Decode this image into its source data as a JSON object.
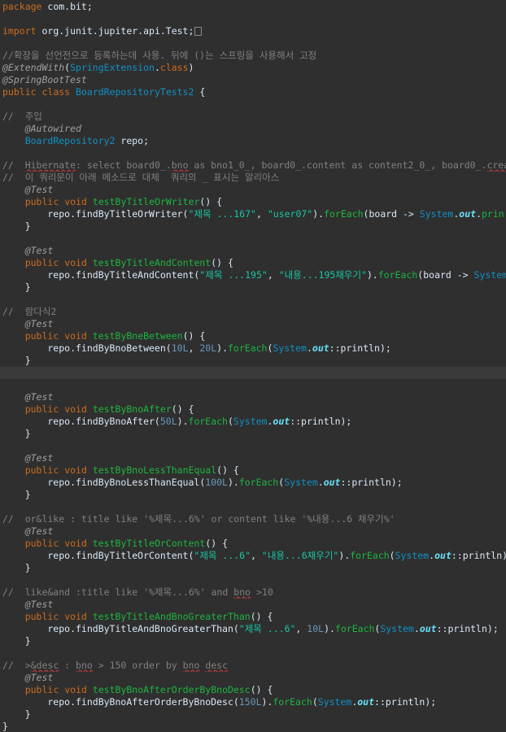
{
  "editor": {
    "current_line": 30,
    "lines": [
      {
        "tokens": [
          {
            "t": "package",
            "c": "kw"
          },
          {
            "t": " com.bit;",
            "c": "tx"
          }
        ]
      },
      {
        "tokens": []
      },
      {
        "tokens": [
          {
            "t": "import",
            "c": "kw"
          },
          {
            "t": " org.junit.jupiter.api.Test;",
            "c": "tx"
          }
        ],
        "fold": true
      },
      {
        "tokens": []
      },
      {
        "tokens": [
          {
            "t": "//확장을 선언전으로 등록하는데 사용. 뒤에 ()는 스프링을 사용해서 고정",
            "c": "cm"
          }
        ]
      },
      {
        "tokens": [
          {
            "t": "@ExtendWith",
            "c": "ann"
          },
          {
            "t": "(",
            "c": "tx"
          },
          {
            "t": "SpringExtension",
            "c": "cls"
          },
          {
            "t": ".",
            "c": "tx"
          },
          {
            "t": "class",
            "c": "kw"
          },
          {
            "t": ")",
            "c": "tx"
          }
        ]
      },
      {
        "tokens": [
          {
            "t": "@SpringBootTest",
            "c": "ann"
          }
        ]
      },
      {
        "tokens": [
          {
            "t": "public",
            "c": "kw"
          },
          {
            "t": " ",
            "c": "tx"
          },
          {
            "t": "class",
            "c": "kw"
          },
          {
            "t": " ",
            "c": "tx"
          },
          {
            "t": "BoardRepositoryTests2",
            "c": "cls"
          },
          {
            "t": " {",
            "c": "tx"
          }
        ]
      },
      {
        "tokens": []
      },
      {
        "tokens": [
          {
            "t": "//  주입",
            "c": "cm"
          }
        ]
      },
      {
        "tokens": [
          {
            "t": "    ",
            "c": "tx"
          },
          {
            "t": "@Autowired",
            "c": "ann"
          }
        ]
      },
      {
        "tokens": [
          {
            "t": "    ",
            "c": "tx"
          },
          {
            "t": "BoardRepository2",
            "c": "cls"
          },
          {
            "t": " repo;",
            "c": "tx"
          }
        ]
      },
      {
        "tokens": []
      },
      {
        "tokens": [
          {
            "t": "//  ",
            "c": "cm"
          },
          {
            "t": "Hibernate",
            "c": "cm",
            "sq": true
          },
          {
            "t": ": select board0_.",
            "c": "cm"
          },
          {
            "t": "bno",
            "c": "cm",
            "sq": true
          },
          {
            "t": " as bno1_0_, board0_.content as content2_0_, board0_.",
            "c": "cm"
          },
          {
            "t": "crea",
            "c": "cm",
            "sq": true
          }
        ]
      },
      {
        "tokens": [
          {
            "t": "//  이 쿼리문이 아래 메소드로 대체  쿼리의 _ 표시는 알리아스",
            "c": "cm"
          }
        ]
      },
      {
        "tokens": [
          {
            "t": "    ",
            "c": "tx"
          },
          {
            "t": "@Test",
            "c": "ann"
          }
        ]
      },
      {
        "tokens": [
          {
            "t": "    ",
            "c": "tx"
          },
          {
            "t": "public",
            "c": "kw"
          },
          {
            "t": " ",
            "c": "tx"
          },
          {
            "t": "void",
            "c": "kw"
          },
          {
            "t": " ",
            "c": "tx"
          },
          {
            "t": "testByTitleOrWriter",
            "c": "mth"
          },
          {
            "t": "() {",
            "c": "tx"
          }
        ]
      },
      {
        "tokens": [
          {
            "t": "        repo.findByTitleOrWriter(",
            "c": "tx"
          },
          {
            "t": "\"제목 ...167\"",
            "c": "str"
          },
          {
            "t": ", ",
            "c": "tx"
          },
          {
            "t": "\"user07\"",
            "c": "str"
          },
          {
            "t": ").",
            "c": "tx"
          },
          {
            "t": "forEach",
            "c": "mth"
          },
          {
            "t": "(board -> ",
            "c": "tx"
          },
          {
            "t": "System",
            "c": "cls"
          },
          {
            "t": ".",
            "c": "tx"
          },
          {
            "t": "out",
            "c": "fld"
          },
          {
            "t": ".",
            "c": "tx"
          },
          {
            "t": "prin",
            "c": "mth"
          }
        ]
      },
      {
        "tokens": [
          {
            "t": "    }",
            "c": "tx"
          }
        ]
      },
      {
        "tokens": []
      },
      {
        "tokens": [
          {
            "t": "    ",
            "c": "tx"
          },
          {
            "t": "@Test",
            "c": "ann"
          }
        ]
      },
      {
        "tokens": [
          {
            "t": "    ",
            "c": "tx"
          },
          {
            "t": "public",
            "c": "kw"
          },
          {
            "t": " ",
            "c": "tx"
          },
          {
            "t": "void",
            "c": "kw"
          },
          {
            "t": " ",
            "c": "tx"
          },
          {
            "t": "testByTitleAndContent",
            "c": "mth"
          },
          {
            "t": "() {",
            "c": "tx"
          }
        ]
      },
      {
        "tokens": [
          {
            "t": "        repo.findByTitleAndContent(",
            "c": "tx"
          },
          {
            "t": "\"제목 ...195\"",
            "c": "str"
          },
          {
            "t": ", ",
            "c": "tx"
          },
          {
            "t": "\"내용...195채우기\"",
            "c": "str"
          },
          {
            "t": ").",
            "c": "tx"
          },
          {
            "t": "forEach",
            "c": "mth"
          },
          {
            "t": "(board -> ",
            "c": "tx"
          },
          {
            "t": "System",
            "c": "cls"
          }
        ]
      },
      {
        "tokens": [
          {
            "t": "    }",
            "c": "tx"
          }
        ]
      },
      {
        "tokens": []
      },
      {
        "tokens": [
          {
            "t": "//  람다식2",
            "c": "cm"
          }
        ]
      },
      {
        "tokens": [
          {
            "t": "    ",
            "c": "tx"
          },
          {
            "t": "@Test",
            "c": "ann"
          }
        ]
      },
      {
        "tokens": [
          {
            "t": "    ",
            "c": "tx"
          },
          {
            "t": "public",
            "c": "kw"
          },
          {
            "t": " ",
            "c": "tx"
          },
          {
            "t": "void",
            "c": "kw"
          },
          {
            "t": " ",
            "c": "tx"
          },
          {
            "t": "testByBneBetween",
            "c": "mth"
          },
          {
            "t": "() {",
            "c": "tx"
          }
        ]
      },
      {
        "tokens": [
          {
            "t": "        repo.findByBnoBetween(",
            "c": "tx"
          },
          {
            "t": "10L",
            "c": "num"
          },
          {
            "t": ", ",
            "c": "tx"
          },
          {
            "t": "20L",
            "c": "num"
          },
          {
            "t": ").",
            "c": "tx"
          },
          {
            "t": "forEach",
            "c": "mth"
          },
          {
            "t": "(",
            "c": "tx"
          },
          {
            "t": "System",
            "c": "cls"
          },
          {
            "t": ".",
            "c": "tx"
          },
          {
            "t": "out",
            "c": "fld"
          },
          {
            "t": "::println);",
            "c": "tx"
          }
        ]
      },
      {
        "tokens": [
          {
            "t": "    }",
            "c": "tx"
          }
        ]
      },
      {
        "tokens": []
      },
      {
        "tokens": []
      },
      {
        "tokens": [
          {
            "t": "    ",
            "c": "tx"
          },
          {
            "t": "@Test",
            "c": "ann"
          }
        ]
      },
      {
        "tokens": [
          {
            "t": "    ",
            "c": "tx"
          },
          {
            "t": "public",
            "c": "kw"
          },
          {
            "t": " ",
            "c": "tx"
          },
          {
            "t": "void",
            "c": "kw"
          },
          {
            "t": " ",
            "c": "tx"
          },
          {
            "t": "testByBnoAfter",
            "c": "mth"
          },
          {
            "t": "() {",
            "c": "tx"
          }
        ]
      },
      {
        "tokens": [
          {
            "t": "        repo.findByBnoAfter(",
            "c": "tx"
          },
          {
            "t": "50L",
            "c": "num"
          },
          {
            "t": ").",
            "c": "tx"
          },
          {
            "t": "forEach",
            "c": "mth"
          },
          {
            "t": "(",
            "c": "tx"
          },
          {
            "t": "System",
            "c": "cls"
          },
          {
            "t": ".",
            "c": "tx"
          },
          {
            "t": "out",
            "c": "fld"
          },
          {
            "t": "::println);",
            "c": "tx"
          }
        ]
      },
      {
        "tokens": [
          {
            "t": "    }",
            "c": "tx"
          }
        ]
      },
      {
        "tokens": []
      },
      {
        "tokens": [
          {
            "t": "    ",
            "c": "tx"
          },
          {
            "t": "@Test",
            "c": "ann"
          }
        ]
      },
      {
        "tokens": [
          {
            "t": "    ",
            "c": "tx"
          },
          {
            "t": "public",
            "c": "kw"
          },
          {
            "t": " ",
            "c": "tx"
          },
          {
            "t": "void",
            "c": "kw"
          },
          {
            "t": " ",
            "c": "tx"
          },
          {
            "t": "testByBnoLessThanEqual",
            "c": "mth"
          },
          {
            "t": "() {",
            "c": "tx"
          }
        ]
      },
      {
        "tokens": [
          {
            "t": "        repo.findByBnoLessThanEqual(",
            "c": "tx"
          },
          {
            "t": "100L",
            "c": "num"
          },
          {
            "t": ").",
            "c": "tx"
          },
          {
            "t": "forEach",
            "c": "mth"
          },
          {
            "t": "(",
            "c": "tx"
          },
          {
            "t": "System",
            "c": "cls"
          },
          {
            "t": ".",
            "c": "tx"
          },
          {
            "t": "out",
            "c": "fld"
          },
          {
            "t": "::println);",
            "c": "tx"
          }
        ]
      },
      {
        "tokens": [
          {
            "t": "    }",
            "c": "tx"
          }
        ]
      },
      {
        "tokens": []
      },
      {
        "tokens": [
          {
            "t": "//  or&like : title like '%제목...6%' or content like '%내용...6 채우기%'",
            "c": "cm"
          }
        ]
      },
      {
        "tokens": [
          {
            "t": "    ",
            "c": "tx"
          },
          {
            "t": "@Test",
            "c": "ann"
          }
        ]
      },
      {
        "tokens": [
          {
            "t": "    ",
            "c": "tx"
          },
          {
            "t": "public",
            "c": "kw"
          },
          {
            "t": " ",
            "c": "tx"
          },
          {
            "t": "void",
            "c": "kw"
          },
          {
            "t": " ",
            "c": "tx"
          },
          {
            "t": "testByTitleOrContent",
            "c": "mth"
          },
          {
            "t": "() {",
            "c": "tx"
          }
        ]
      },
      {
        "tokens": [
          {
            "t": "        repo.findByTitleOrContent(",
            "c": "tx"
          },
          {
            "t": "\"제목 ...6\"",
            "c": "str"
          },
          {
            "t": ", ",
            "c": "tx"
          },
          {
            "t": "\"내용...6채우기\"",
            "c": "str"
          },
          {
            "t": ").",
            "c": "tx"
          },
          {
            "t": "forEach",
            "c": "mth"
          },
          {
            "t": "(",
            "c": "tx"
          },
          {
            "t": "System",
            "c": "cls"
          },
          {
            "t": ".",
            "c": "tx"
          },
          {
            "t": "out",
            "c": "fld"
          },
          {
            "t": "::println)",
            "c": "tx"
          }
        ]
      },
      {
        "tokens": [
          {
            "t": "    }",
            "c": "tx"
          }
        ]
      },
      {
        "tokens": []
      },
      {
        "tokens": [
          {
            "t": "//  like&and :title like '%제목...6%' and ",
            "c": "cm"
          },
          {
            "t": "bno",
            "c": "cm",
            "sq": true
          },
          {
            "t": " >10",
            "c": "cm"
          }
        ]
      },
      {
        "tokens": [
          {
            "t": "    ",
            "c": "tx"
          },
          {
            "t": "@Test",
            "c": "ann"
          }
        ]
      },
      {
        "tokens": [
          {
            "t": "    ",
            "c": "tx"
          },
          {
            "t": "public",
            "c": "kw"
          },
          {
            "t": " ",
            "c": "tx"
          },
          {
            "t": "void",
            "c": "kw"
          },
          {
            "t": " ",
            "c": "tx"
          },
          {
            "t": "testByTitleAndBnoGreaterThan",
            "c": "mth"
          },
          {
            "t": "() {",
            "c": "tx"
          }
        ]
      },
      {
        "tokens": [
          {
            "t": "        repo.findByTitleAndBnoGreaterThan(",
            "c": "tx"
          },
          {
            "t": "\"제목 ...6\"",
            "c": "str"
          },
          {
            "t": ", ",
            "c": "tx"
          },
          {
            "t": "10L",
            "c": "num"
          },
          {
            "t": ").",
            "c": "tx"
          },
          {
            "t": "forEach",
            "c": "mth"
          },
          {
            "t": "(",
            "c": "tx"
          },
          {
            "t": "System",
            "c": "cls"
          },
          {
            "t": ".",
            "c": "tx"
          },
          {
            "t": "out",
            "c": "fld"
          },
          {
            "t": "::println);",
            "c": "tx"
          }
        ]
      },
      {
        "tokens": [
          {
            "t": "    }",
            "c": "tx"
          }
        ]
      },
      {
        "tokens": []
      },
      {
        "tokens": [
          {
            "t": "//  >",
            "c": "cm"
          },
          {
            "t": "&desc",
            "c": "cm",
            "sq": true
          },
          {
            "t": " : ",
            "c": "cm"
          },
          {
            "t": "bno",
            "c": "cm",
            "sq": true
          },
          {
            "t": " > 150 order by ",
            "c": "cm"
          },
          {
            "t": "bno",
            "c": "cm",
            "sq": true
          },
          {
            "t": " ",
            "c": "cm"
          },
          {
            "t": "desc",
            "c": "cm",
            "sq": true
          }
        ]
      },
      {
        "tokens": [
          {
            "t": "    ",
            "c": "tx"
          },
          {
            "t": "@Test",
            "c": "ann"
          }
        ]
      },
      {
        "tokens": [
          {
            "t": "    ",
            "c": "tx"
          },
          {
            "t": "public",
            "c": "kw"
          },
          {
            "t": " ",
            "c": "tx"
          },
          {
            "t": "void",
            "c": "kw"
          },
          {
            "t": " ",
            "c": "tx"
          },
          {
            "t": "testByBnoAfterOrderByBnoDesc",
            "c": "mth"
          },
          {
            "t": "() {",
            "c": "tx"
          }
        ]
      },
      {
        "tokens": [
          {
            "t": "        repo.findByBnoAfterOrderByBnoDesc(",
            "c": "tx"
          },
          {
            "t": "150L",
            "c": "num"
          },
          {
            "t": ").",
            "c": "tx"
          },
          {
            "t": "forEach",
            "c": "mth"
          },
          {
            "t": "(",
            "c": "tx"
          },
          {
            "t": "System",
            "c": "cls"
          },
          {
            "t": ".",
            "c": "tx"
          },
          {
            "t": "out",
            "c": "fld"
          },
          {
            "t": "::println);",
            "c": "tx"
          }
        ]
      },
      {
        "tokens": [
          {
            "t": "    }",
            "c": "tx"
          }
        ]
      },
      {
        "tokens": [
          {
            "t": "}",
            "c": "tx"
          }
        ]
      }
    ]
  }
}
